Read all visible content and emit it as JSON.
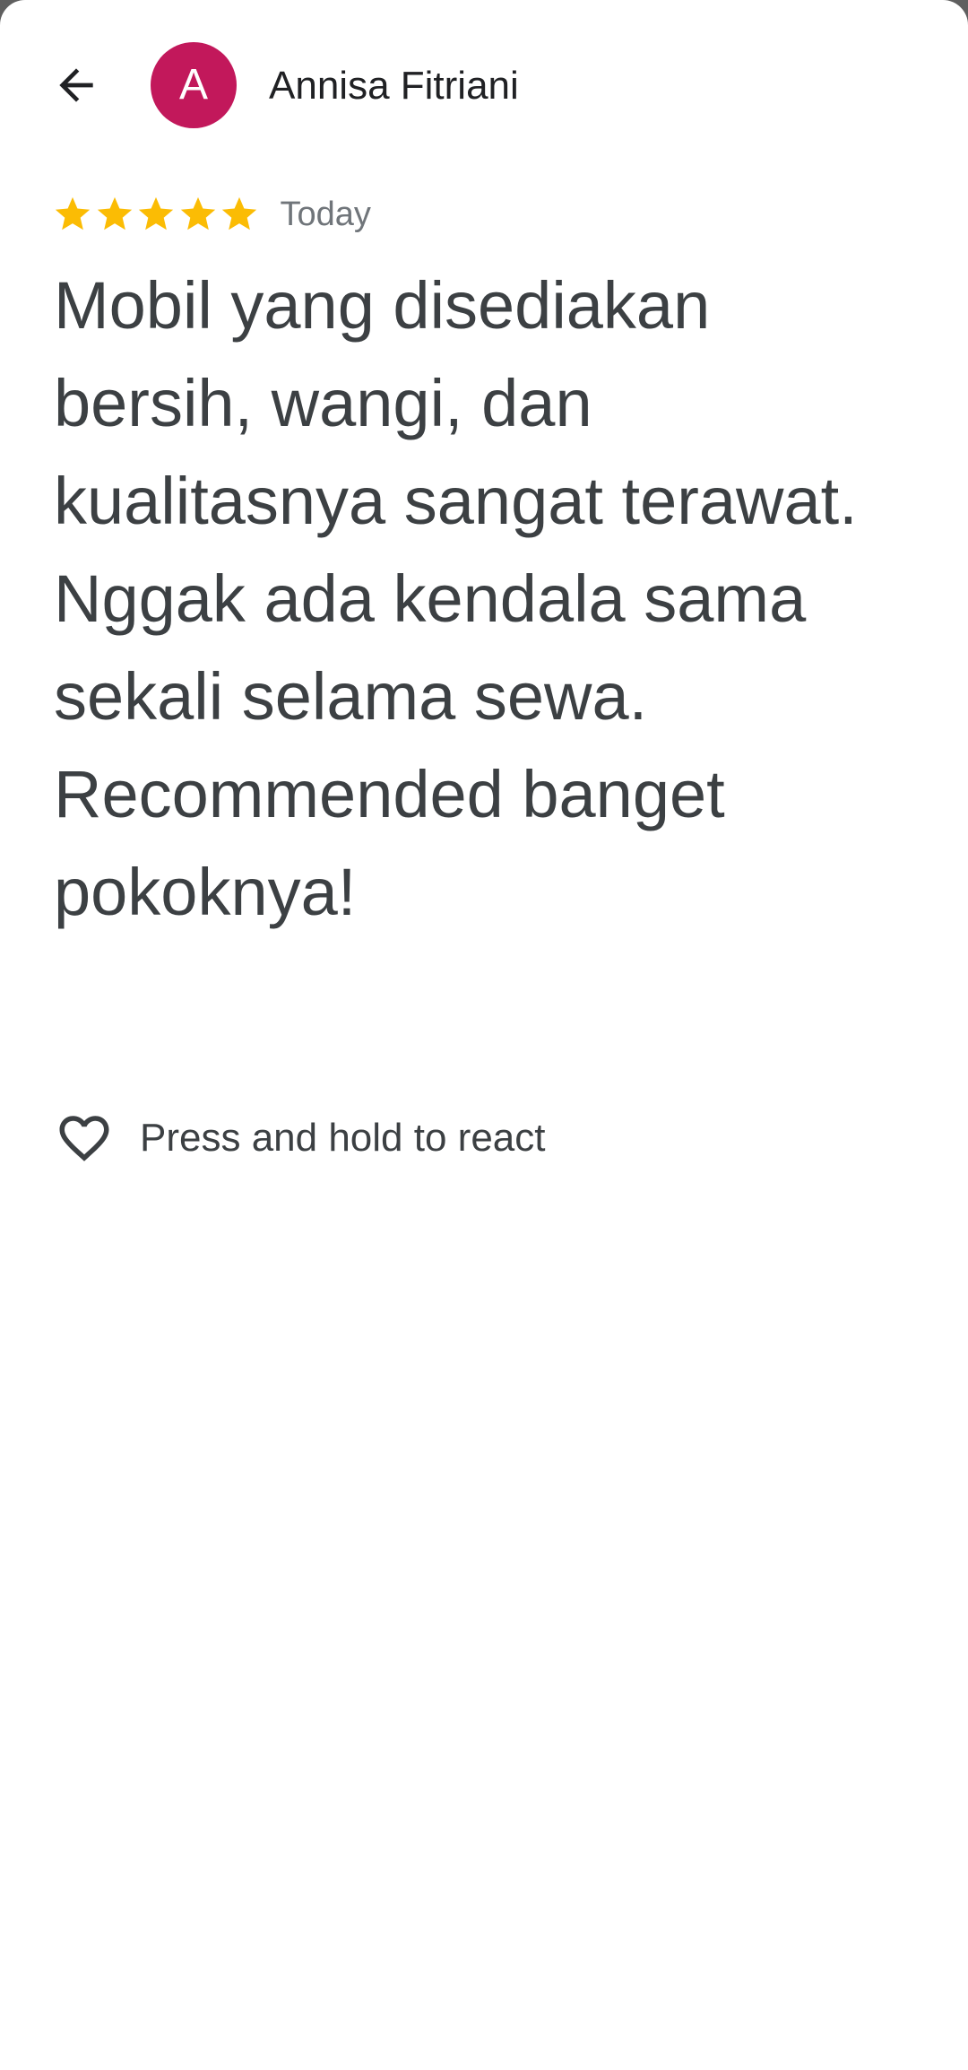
{
  "header": {
    "back_icon": "arrow-back-icon",
    "avatar_letter": "A",
    "avatar_color": "#c2185b",
    "author_name": "Annisa Fitriani"
  },
  "review": {
    "rating": 5,
    "rating_max": 5,
    "star_icon": "star-icon",
    "star_color": "#fbbc04",
    "date": "Today",
    "text": "Mobil yang disediakan bersih, wangi, dan kualitasnya sangat terawat. Nggak ada kendala sama sekali selama sewa. Recommended banget pokoknya!"
  },
  "reaction": {
    "icon": "heart-outline-icon",
    "label": "Press and hold to react"
  }
}
